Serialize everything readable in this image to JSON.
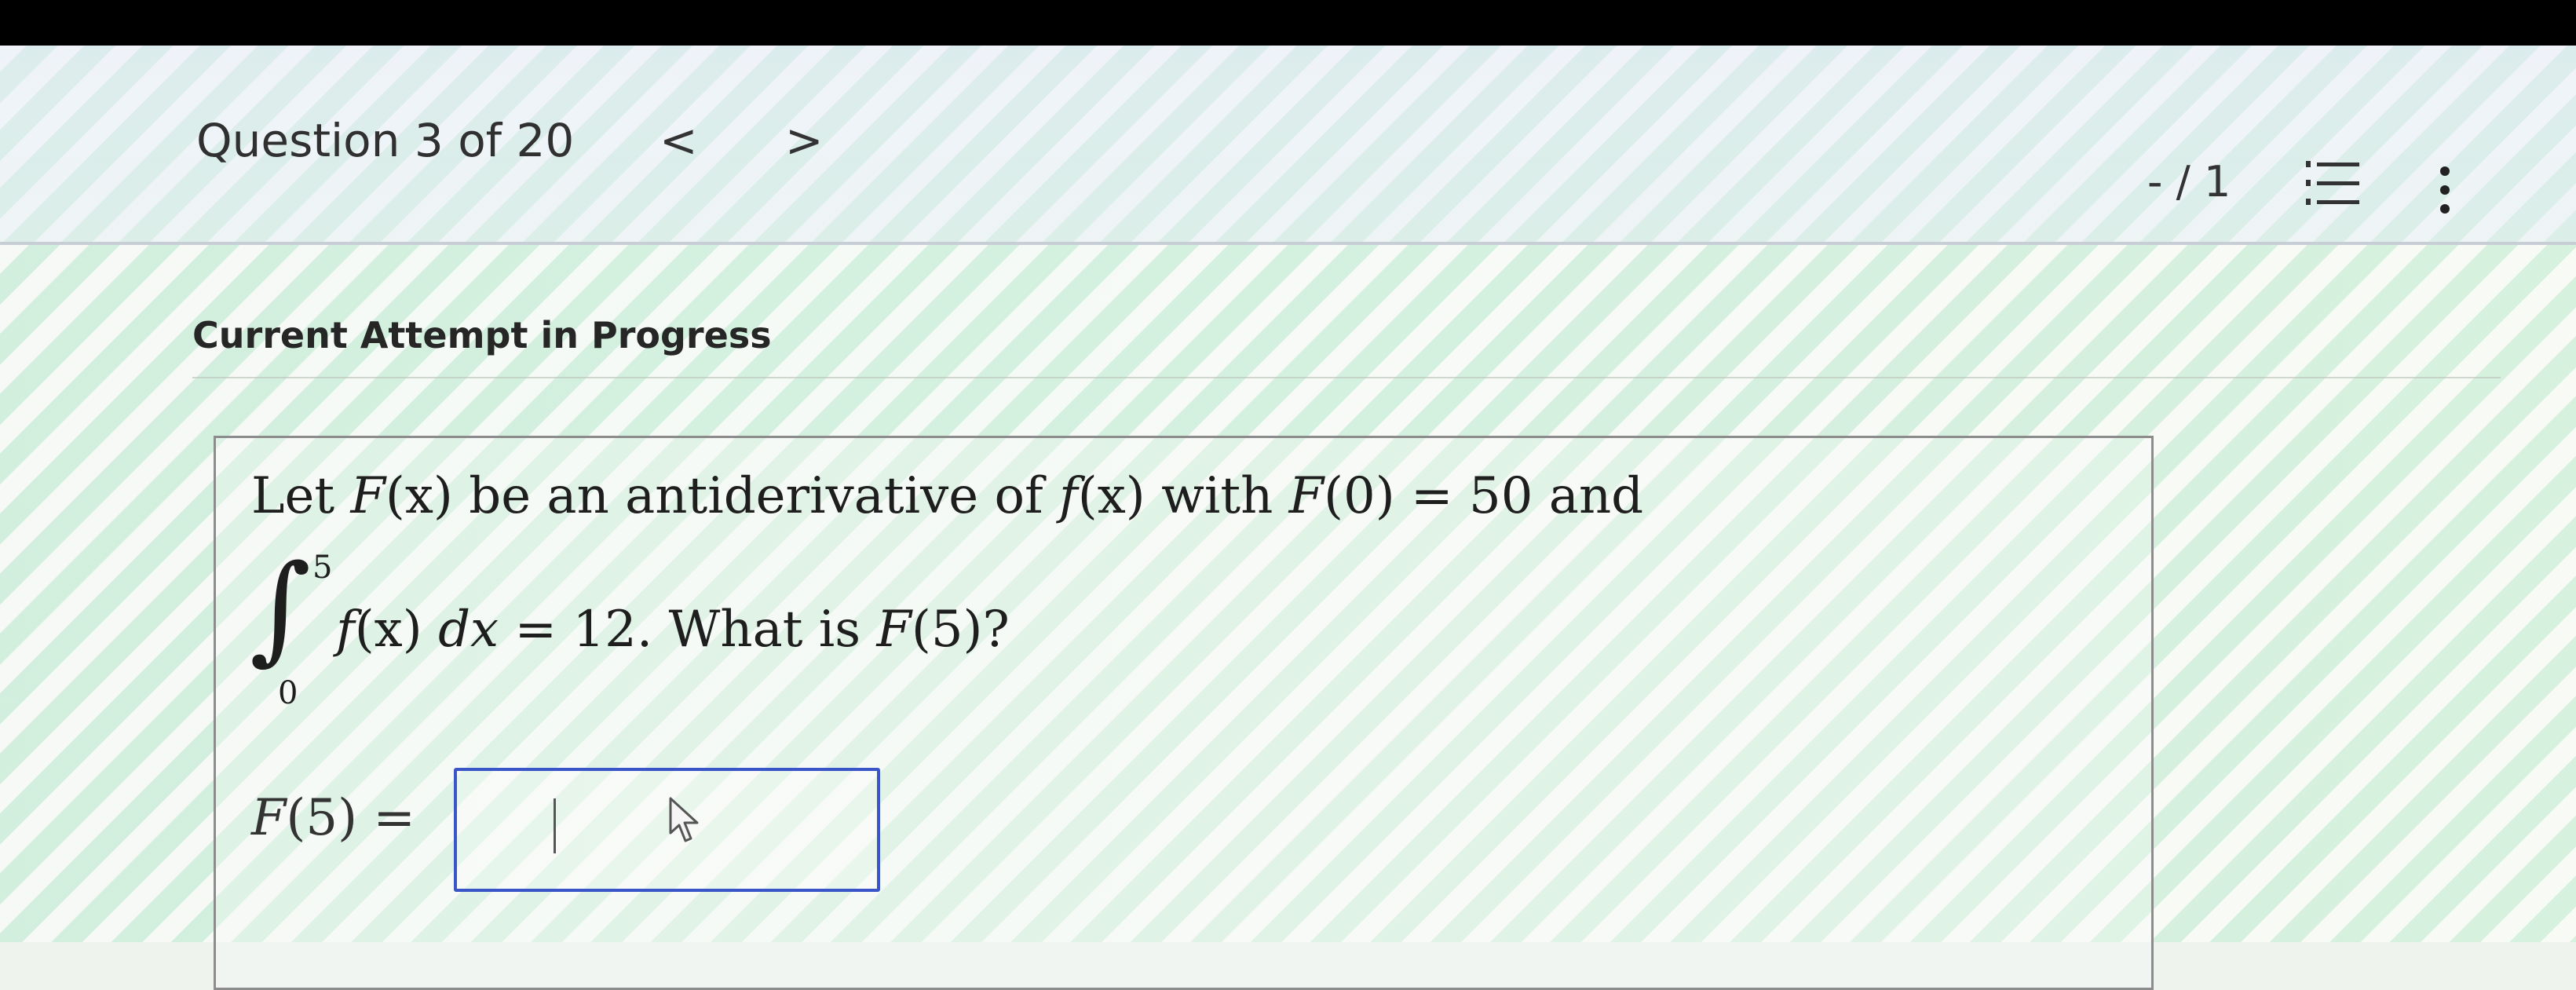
{
  "header": {
    "question_label": "Question 3 of 20",
    "prev_glyph": "<",
    "next_glyph": ">",
    "score": "- / 1",
    "list_icon": "numbered-list-icon",
    "more_icon": "vertical-ellipsis-icon"
  },
  "status": {
    "attempt_label": "Current Attempt in Progress"
  },
  "question": {
    "line1": {
      "t1": "Let ",
      "F": "F",
      "x1": "(x)",
      "t2": " be an antiderivative of ",
      "f": "f",
      "x2": "(x)",
      "t3": " with ",
      "F2": "F",
      "t4": "(0) = 50 and"
    },
    "integral": {
      "sign": "∫",
      "upper": "5",
      "lower": "0",
      "f": "f",
      "x": "(x) ",
      "dx": "dx",
      "t1": " = 12. What is ",
      "F": "F",
      "t2": "(5)?"
    }
  },
  "answer": {
    "label_F": "F",
    "label_rest": "(5) =",
    "input_value": ""
  },
  "colors": {
    "input_border": "#3a55c7",
    "header_background": "#e6edf6",
    "stripe_green": "#b6eccd"
  }
}
